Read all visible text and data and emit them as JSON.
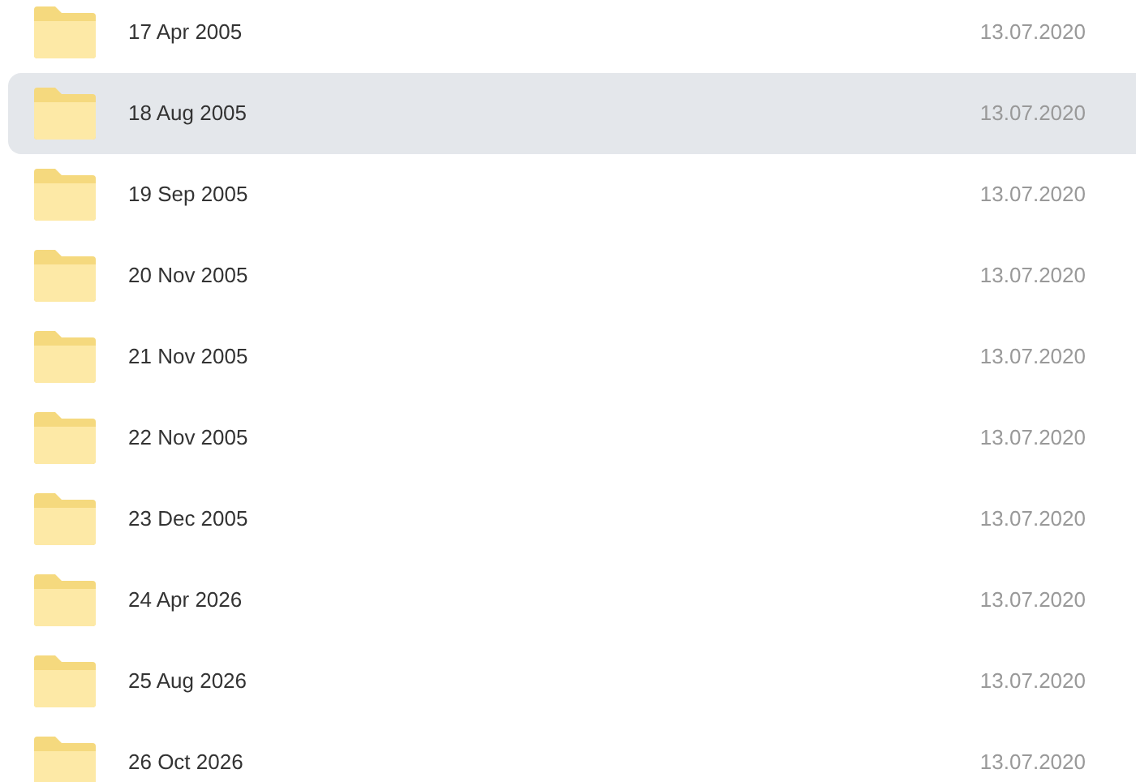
{
  "files": [
    {
      "name": "17 Apr 2005",
      "date": "13.07.2020",
      "selected": false
    },
    {
      "name": "18 Aug 2005",
      "date": "13.07.2020",
      "selected": true
    },
    {
      "name": "19 Sep 2005",
      "date": "13.07.2020",
      "selected": false
    },
    {
      "name": "20 Nov 2005",
      "date": "13.07.2020",
      "selected": false
    },
    {
      "name": "21 Nov 2005",
      "date": "13.07.2020",
      "selected": false
    },
    {
      "name": "22 Nov 2005",
      "date": "13.07.2020",
      "selected": false
    },
    {
      "name": "23 Dec 2005",
      "date": "13.07.2020",
      "selected": false
    },
    {
      "name": "24 Apr 2026",
      "date": "13.07.2020",
      "selected": false
    },
    {
      "name": "25 Aug 2026",
      "date": "13.07.2020",
      "selected": false
    },
    {
      "name": "26 Oct 2026",
      "date": "13.07.2020",
      "selected": false
    }
  ]
}
